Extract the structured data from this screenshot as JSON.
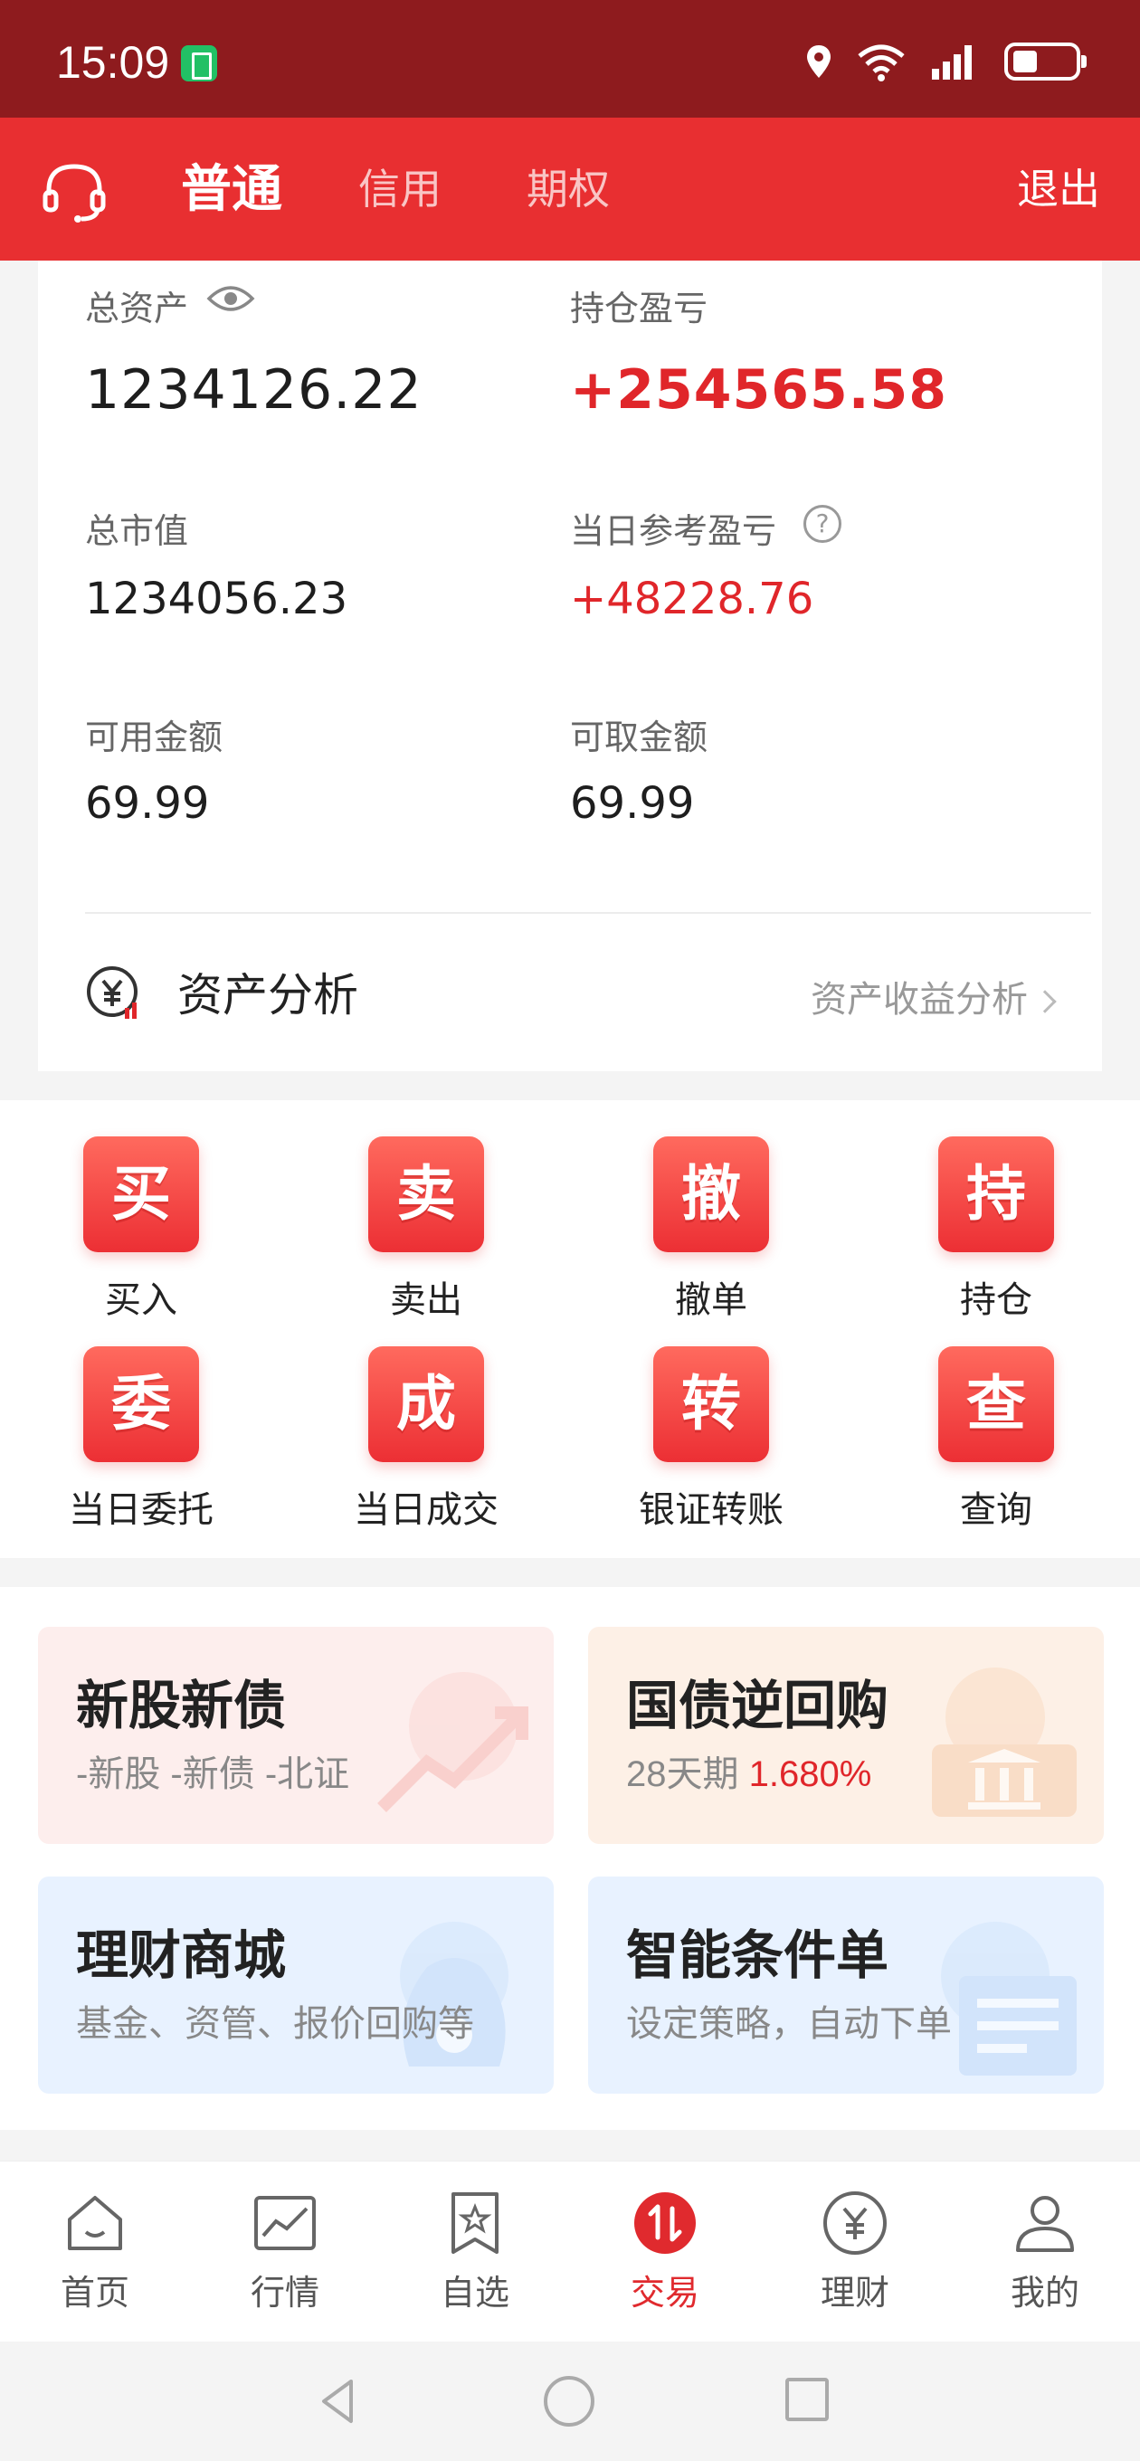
{
  "status_bar": {
    "time": "15:09"
  },
  "header": {
    "tabs": [
      {
        "label": "普通",
        "active": true
      },
      {
        "label": "信用",
        "active": false
      },
      {
        "label": "期权",
        "active": false
      }
    ],
    "logout_label": "退出"
  },
  "assets": {
    "total_assets_label": "总资产",
    "total_assets_value": "1234126.22",
    "position_pnl_label": "持仓盈亏",
    "position_pnl_value": "+254565.58",
    "market_value_label": "总市值",
    "market_value_value": "1234056.23",
    "daily_pnl_label": "当日参考盈亏",
    "daily_pnl_value": "+48228.76",
    "available_label": "可用金额",
    "available_value": "69.99",
    "withdrawable_label": "可取金额",
    "withdrawable_value": "69.99",
    "analysis_title": "资产分析",
    "analysis_link": "资产收益分析"
  },
  "actions": [
    {
      "glyph": "买",
      "label": "买入"
    },
    {
      "glyph": "卖",
      "label": "卖出"
    },
    {
      "glyph": "撤",
      "label": "撤单"
    },
    {
      "glyph": "持",
      "label": "持仓"
    },
    {
      "glyph": "委",
      "label": "当日委托"
    },
    {
      "glyph": "成",
      "label": "当日成交"
    },
    {
      "glyph": "转",
      "label": "银证转账"
    },
    {
      "glyph": "查",
      "label": "查询"
    }
  ],
  "promos": [
    {
      "title": "新股新债",
      "subtitle": "-新股 -新债 -北证"
    },
    {
      "title": "国债逆回购",
      "subtitle_prefix": "28天期 ",
      "subtitle_rate": "1.680%"
    },
    {
      "title": "理财商城",
      "subtitle": "基金、资管、报价回购等"
    },
    {
      "title": "智能条件单",
      "subtitle": "设定策略，自动下单"
    }
  ],
  "tabbar": [
    {
      "label": "首页",
      "icon": "home-icon"
    },
    {
      "label": "行情",
      "icon": "chart-icon"
    },
    {
      "label": "自选",
      "icon": "bookmark-star-icon"
    },
    {
      "label": "交易",
      "icon": "trade-icon",
      "active": true
    },
    {
      "label": "理财",
      "icon": "yuan-icon"
    },
    {
      "label": "我的",
      "icon": "user-icon"
    }
  ],
  "colors": {
    "brand_red": "#e82f31",
    "status_bar": "#8e1b1e",
    "gain_red": "#e0262a"
  }
}
